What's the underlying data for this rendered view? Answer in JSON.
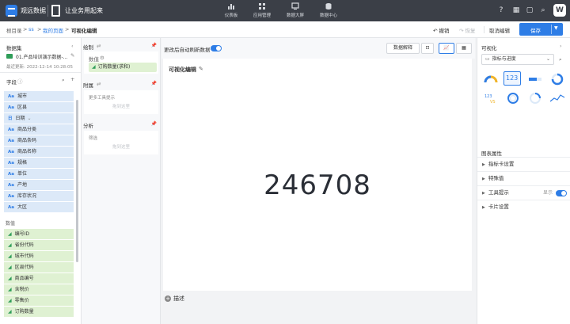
{
  "topbar": {
    "brand": "观远数据",
    "app_title": "让业务用起来",
    "nav": [
      "仪表板",
      "应用管理",
      "数据大屏",
      "数据中心"
    ],
    "avatar": "W"
  },
  "breadcrumb": {
    "root": "根目录",
    "sep": ">",
    "level1": "ss",
    "level2": "我的页面",
    "current": "可视化编辑"
  },
  "toolbar": {
    "undo": "撤销",
    "redo": "恢复",
    "cancel": "取消编辑",
    "save": "保存"
  },
  "dataset_panel": {
    "title": "数据集",
    "name": "01.产品培训演示数据-...",
    "updated": "最近更新: 2022-12-14 10:28:05",
    "fields_title": "字段",
    "dimensions": [
      "城市",
      "区县",
      "日期",
      "商品分类",
      "商品条码",
      "商品名称",
      "规格",
      "单位",
      "产地",
      "库存状况",
      "大区"
    ],
    "dimension_type": "Aa",
    "date_type": "日",
    "measures_title": "数值",
    "measures": [
      "编号ID",
      "省份代码",
      "城市代码",
      "区县代码",
      "商品编号",
      "含税价",
      "零售价",
      "订购数量"
    ]
  },
  "mid_panel": {
    "drawing_title": "绘制",
    "value_label": "数值",
    "value_chip": "订购数量(求和)",
    "attach_title": "附属",
    "attach_hint": "更多工具提示",
    "drag_here": "拖到这里",
    "analysis_title": "分析",
    "filter_label": "筛选"
  },
  "canvas": {
    "auto_refresh": "更改后自动刷新数据",
    "explain": "数据解释",
    "title": "可视化编辑",
    "value": "246708",
    "describe": "描述"
  },
  "viz_panel": {
    "title": "可视化",
    "chart_type": "指标与进度",
    "thumbs": [
      "gauge",
      "123",
      "bar",
      "ring",
      "123vs",
      "ring2",
      "ring3",
      "spark"
    ],
    "props_title": "图表属性",
    "props": [
      "指标卡设置",
      "特殊值",
      "工具提示",
      "卡片设置"
    ],
    "tooltip_state": "显示"
  },
  "colors": {
    "accent": "#2e7de6",
    "dimension_bg": "#dce9f8",
    "measure_bg": "#dff1d2",
    "topbar": "#3b3f47"
  }
}
